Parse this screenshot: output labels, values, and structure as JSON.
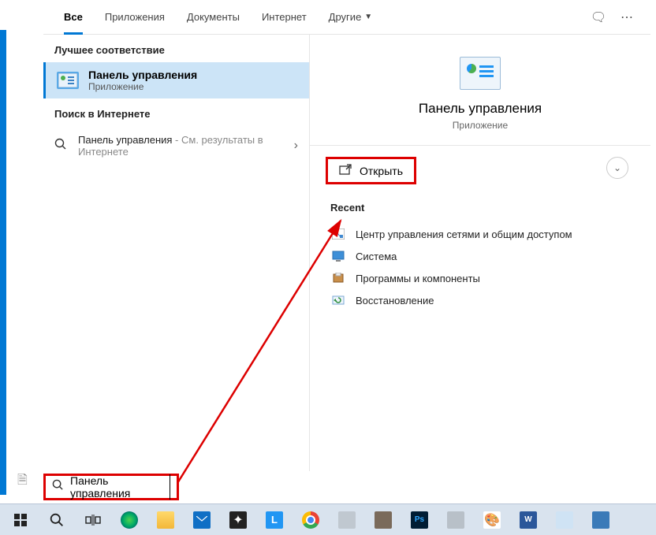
{
  "tabs": {
    "all": "Все",
    "apps": "Приложения",
    "docs": "Документы",
    "web": "Интернет",
    "more": "Другие"
  },
  "left": {
    "best_header": "Лучшее соответствие",
    "best_title": "Панель управления",
    "best_sub": "Приложение",
    "web_header": "Поиск в Интернете",
    "web_query": "Панель управления",
    "web_suffix": " - См. результаты в Интернете"
  },
  "right": {
    "title": "Панель управления",
    "sub": "Приложение",
    "open": "Открыть",
    "recent_header": "Recent",
    "recent": [
      "Центр управления сетями и общим доступом",
      "Система",
      "Программы и компоненты",
      "Восстановление"
    ]
  },
  "searchbox": "Панель управления"
}
